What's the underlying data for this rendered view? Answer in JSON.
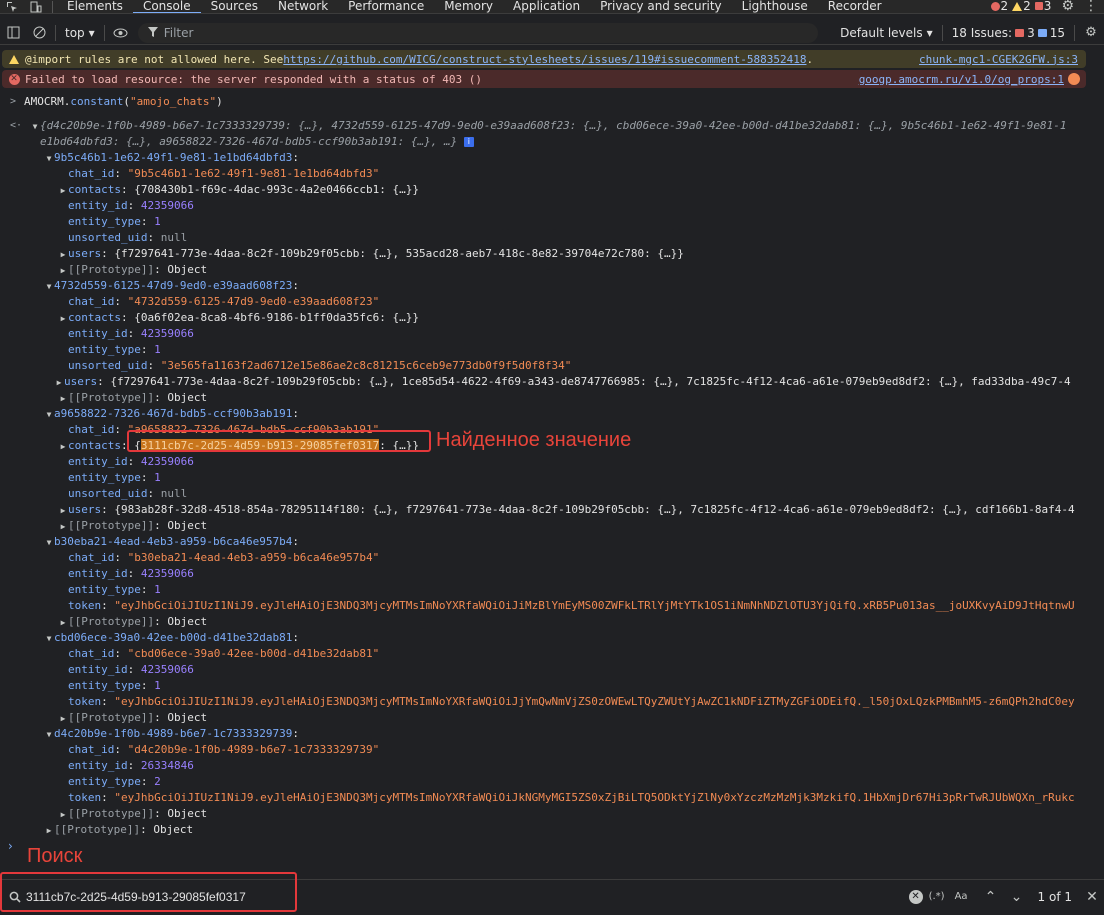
{
  "tabs": {
    "items": [
      "Elements",
      "Console",
      "Sources",
      "Network",
      "Performance",
      "Memory",
      "Application",
      "Privacy and security",
      "Lighthouse",
      "Recorder"
    ],
    "active": "Console",
    "counts": {
      "errors": "2",
      "warnings": "2",
      "other": "3"
    }
  },
  "toolbar": {
    "context": "top",
    "filter_placeholder": "Filter",
    "levels": "Default levels",
    "issues_label": "18 Issues:",
    "issues_errors": "3",
    "issues_info": "15"
  },
  "messages": {
    "warning_text": "@import rules are not allowed here. See ",
    "warning_link": "https://github.com/WICG/construct-stylesheets/issues/119#issuecomment-588352418",
    "warning_tail": ".",
    "warning_source": "chunk-mgc1-CGEK2GFW.js:3",
    "error_text": "Failed to load resource: the server responded with a status of 403 ()",
    "error_source": "googp.amocrm.ru/v1.0/og_props:1"
  },
  "command": {
    "obj": "AMOCRM",
    "method": "constant",
    "arg": "\"amojo_chats\""
  },
  "summary": {
    "line1": "{d4c20b9e-1f0b-4989-b6e7-1c7333329739: {…}, 4732d559-6125-47d9-9ed0-e39aad608f23: {…}, cbd06ece-39a0-42ee-b00d-d41be32dab81: {…}, 9b5c46b1-1e62-49f1-9e81-1",
    "line2": "e1bd64dbfd3: {…}, a9658822-7326-467d-bdb5-ccf90b3ab191: {…}, …}"
  },
  "labels": {
    "chat_id": "chat_id",
    "contacts": "contacts",
    "entity_id": "entity_id",
    "entity_type": "entity_type",
    "unsorted_uid": "unsorted_uid",
    "users": "users",
    "token": "token",
    "prototype": "[[Prototype]]",
    "object": "Object",
    "null": "null"
  },
  "chats": [
    {
      "key": "9b5c46b1-1e62-49f1-9e81-1e1bd64dbfd3",
      "chat_id": "\"9b5c46b1-1e62-49f1-9e81-1e1bd64dbfd3\"",
      "contacts": "{708430b1-f69c-4dac-993c-4a2e0466ccb1: {…}}",
      "entity_id": "42359066",
      "entity_type": "1",
      "unsorted_uid": "null",
      "users": "{f7297641-773e-4daa-8c2f-109b29f05cbb: {…}, 535acd28-aeb7-418c-8e82-39704e72c780: {…}}"
    },
    {
      "key": "4732d559-6125-47d9-9ed0-e39aad608f23",
      "chat_id": "\"4732d559-6125-47d9-9ed0-e39aad608f23\"",
      "contacts": "{0a6f02ea-8ca8-4bf6-9186-b1ff0da35fc6: {…}}",
      "entity_id": "42359066",
      "entity_type": "1",
      "unsorted_uid": "\"3e565fa1163f2ad6712e15e86ae2c8c81215c6ceb9e773db0f9f5d0f8f34\"",
      "users": "{f7297641-773e-4daa-8c2f-109b29f05cbb: {…}, 1ce85d54-4622-4f69-a343-de8747766985: {…}, 7c1825fc-4f12-4ca6-a61e-079eb9ed8df2: {…}, fad33dba-49c7-4"
    },
    {
      "key": "a9658822-7326-467d-bdb5-ccf90b3ab191",
      "chat_id": "\"a9658822-7326-467d-bdb5-ccf90b3ab191\"",
      "contacts_pre": "{",
      "contacts_match": "3111cb7c-2d25-4d59-b913-29085fef0317",
      "contacts_post": ": {…}}",
      "entity_id": "42359066",
      "entity_type": "1",
      "unsorted_uid": "null",
      "users": "{983ab28f-32d8-4518-854a-78295114f180: {…}, f7297641-773e-4daa-8c2f-109b29f05cbb: {…}, 7c1825fc-4f12-4ca6-a61e-079eb9ed8df2: {…}, cdf166b1-8af4-4"
    },
    {
      "key": "b30eba21-4ead-4eb3-a959-b6ca46e957b4",
      "chat_id": "\"b30eba21-4ead-4eb3-a959-b6ca46e957b4\"",
      "entity_id": "42359066",
      "entity_type": "1",
      "token": "\"eyJhbGciOiJIUzI1NiJ9.eyJleHAiOjE3NDQ3MjcyMTMsImNoYXRfaWQiOiJiMzBlYmEyMS00ZWFkLTRlYjMtYTk1OS1iNmNhNDZlOTU3YjQifQ.xRB5Pu013as__joUXKvyAiD9JtHqtnwU"
    },
    {
      "key": "cbd06ece-39a0-42ee-b00d-d41be32dab81",
      "chat_id": "\"cbd06ece-39a0-42ee-b00d-d41be32dab81\"",
      "entity_id": "42359066",
      "entity_type": "1",
      "token": "\"eyJhbGciOiJIUzI1NiJ9.eyJleHAiOjE3NDQ3MjcyMTMsImNoYXRfaWQiOiJjYmQwNmVjZS0zOWEwLTQyZWUtYjAwZC1kNDFiZTMyZGFiODEifQ._l50jOxLQzkPMBmhM5-z6mQPh2hdC0ey"
    },
    {
      "key": "d4c20b9e-1f0b-4989-b6e7-1c7333329739",
      "chat_id": "\"d4c20b9e-1f0b-4989-b6e7-1c7333329739\"",
      "entity_id": "26334846",
      "entity_type": "2",
      "token": "\"eyJhbGciOiJIUzI1NiJ9.eyJleHAiOjE3NDQ3MjcyMTMsImNoYXRfaWQiOiJkNGMyMGI5ZS0xZjBiLTQ5ODktYjZlNy0xYzczMzMzMjk3MzkifQ.1HbXmjDr67Hi3pRrTwRJUbWQXn_rRukc"
    }
  ],
  "annotations": {
    "found": "Найденное значение",
    "search": "Поиск"
  },
  "search": {
    "value": "3111cb7c-2d25-4d59-b913-29085fef0317",
    "count": "1 of 1",
    "regex": "(.*)",
    "case": "Aa"
  }
}
